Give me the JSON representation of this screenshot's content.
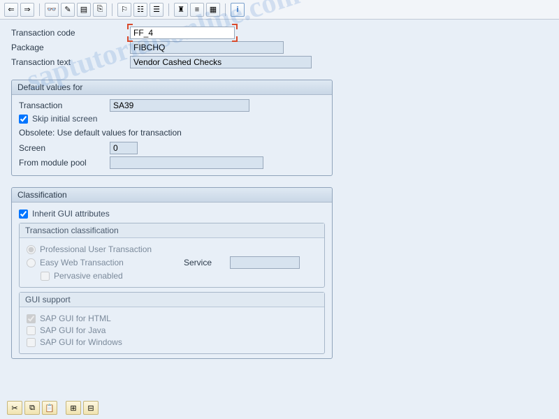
{
  "toolbar": {
    "icons": [
      "back",
      "forward",
      "find",
      "find-next",
      "new",
      "other",
      "tree",
      "hierarchy",
      "assign",
      "where",
      "info"
    ]
  },
  "header": {
    "tcode_label": "Transaction code",
    "tcode_value": "FF_4",
    "package_label": "Package",
    "package_value": "FIBCHQ",
    "ttext_label": "Transaction text",
    "ttext_value": "Vendor Cashed Checks"
  },
  "defaults": {
    "title": "Default values for",
    "transaction_label": "Transaction",
    "transaction_value": "SA39",
    "skip_label": "Skip initial screen",
    "skip_checked": true,
    "obsolete_text": "Obsolete: Use default values for transaction",
    "screen_label": "Screen",
    "screen_value": "0",
    "modulepool_label": "From module pool",
    "modulepool_value": ""
  },
  "classification": {
    "title": "Classification",
    "inherit_label": "Inherit GUI attributes",
    "inherit_checked": true,
    "sub_title": "Transaction classification",
    "prof_label": "Professional User Transaction",
    "easy_label": "Easy Web Transaction",
    "service_label": "Service",
    "service_value": "",
    "pervasive_label": "Pervasive enabled",
    "gui_title": "GUI support",
    "gui_html": "SAP GUI for HTML",
    "gui_java": "SAP GUI for Java",
    "gui_win": "SAP GUI for Windows",
    "gui_html_checked": true,
    "gui_java_checked": false,
    "gui_win_checked": false
  },
  "bottom_toolbar": {
    "icons": [
      "cut",
      "copy",
      "paste",
      "insert-row",
      "delete-row"
    ]
  },
  "watermark": "saptutorialsonline.com"
}
